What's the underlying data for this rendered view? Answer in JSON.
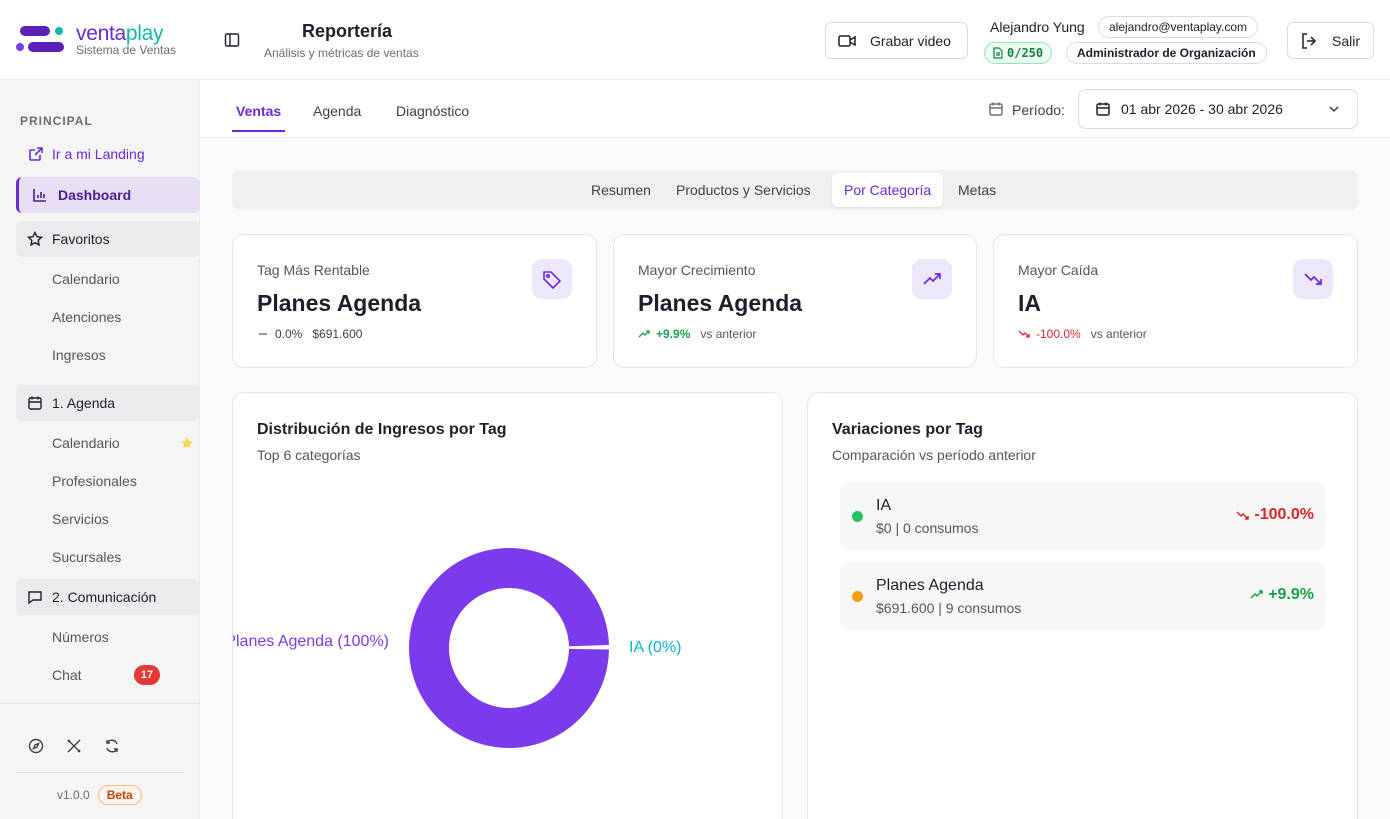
{
  "brand": {
    "name_a": "venta",
    "name_b": "play",
    "subtitle": "Sistema de Ventas"
  },
  "sidebar": {
    "section_label": "PRINCIPAL",
    "landing_link": "Ir a mi Landing",
    "dashboard": "Dashboard",
    "favorites": {
      "label": "Favoritos",
      "items": [
        "Calendario",
        "Atenciones",
        "Ingresos"
      ]
    },
    "agenda": {
      "label": "1. Agenda",
      "items": [
        "Calendario",
        "Profesionales",
        "Servicios",
        "Sucursales"
      ]
    },
    "communication": {
      "label": "2. Comunicación",
      "items": [
        "Números",
        "Chat"
      ],
      "chat_badge": "17"
    },
    "version": "v1.0.0",
    "beta": "Beta"
  },
  "header": {
    "title": "Reportería",
    "subtitle": "Análisis y métricas de ventas",
    "record_button": "Grabar video",
    "user_name": "Alejandro Yung",
    "user_email": "alejandro@ventaplay.com",
    "usage": "0/250",
    "role": "Administrador de Organización",
    "logout_button": "Salir"
  },
  "tabs": [
    "Ventas",
    "Agenda",
    "Diagnóstico"
  ],
  "period": {
    "label": "Período:",
    "value": "01 abr 2026 - 30 abr 2026"
  },
  "subtabs": [
    "Resumen",
    "Productos y Servicios",
    "Por Categoría",
    "Metas"
  ],
  "kpis": [
    {
      "label": "Tag Más Rentable",
      "value": "Planes Agenda",
      "change": "0.0%",
      "extra": "$691.600"
    },
    {
      "label": "Mayor Crecimiento",
      "value": "Planes Agenda",
      "change": "+9.9%",
      "extra": "vs anterior"
    },
    {
      "label": "Mayor Caída",
      "value": "IA",
      "change": "-100.0%",
      "extra": "vs anterior"
    }
  ],
  "distribution": {
    "title": "Distribución de Ingresos por Tag",
    "subtitle": "Top 6 categorías"
  },
  "variations": {
    "title": "Variaciones por Tag",
    "subtitle": "Comparación vs período anterior",
    "rows": [
      {
        "name": "IA",
        "meta": "$0 | 0 consumos",
        "pct": "-100.0%",
        "dot_color": "#22c55e"
      },
      {
        "name": "Planes Agenda",
        "meta": "$691.600 | 9 consumos",
        "pct": "+9.9%",
        "dot_color": "#f59e0b"
      }
    ]
  },
  "chart_data": {
    "type": "pie",
    "categories": [
      "Planes Agenda",
      "IA"
    ],
    "values": [
      100,
      0
    ],
    "labels": [
      "Planes Agenda (100%)",
      "IA (0%)"
    ],
    "colors": [
      "#7c3aed",
      "#06b6d4"
    ],
    "donut": true
  }
}
